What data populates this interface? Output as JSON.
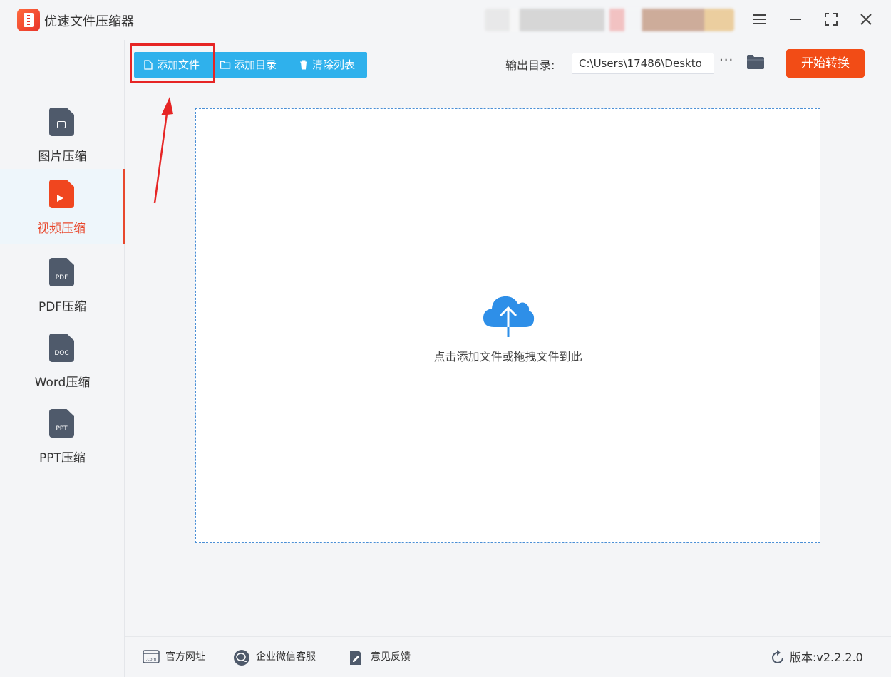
{
  "app": {
    "title": "优速文件压缩器"
  },
  "sidebar": {
    "items": [
      {
        "label": "图片压缩",
        "icon": "image-file-icon",
        "active": false
      },
      {
        "label": "视频压缩",
        "icon": "video-file-icon",
        "active": true
      },
      {
        "label": "PDF压缩",
        "icon": "pdf-file-icon",
        "tag": "PDF",
        "active": false
      },
      {
        "label": "Word压缩",
        "icon": "doc-file-icon",
        "tag": "DOC",
        "active": false
      },
      {
        "label": "PPT压缩",
        "icon": "ppt-file-icon",
        "tag": "PPT",
        "active": false
      }
    ]
  },
  "toolbar": {
    "add_file": "添加文件",
    "add_dir": "添加目录",
    "clear_list": "清除列表",
    "output_label": "输出目录:",
    "output_path": "C:\\Users\\17486\\Deskto",
    "more": "···",
    "start": "开始转换"
  },
  "dropzone": {
    "text": "点击添加文件或拖拽文件到此"
  },
  "footer": {
    "site": "官方网址",
    "wechat": "企业微信客服",
    "feedback": "意见反馈",
    "version": "版本:v2.2.2.0"
  },
  "colors": {
    "accent_blue": "#2fb1ec",
    "accent_orange": "#f24c16",
    "active_red": "#e8482d",
    "annotation_red": "#e62525"
  }
}
